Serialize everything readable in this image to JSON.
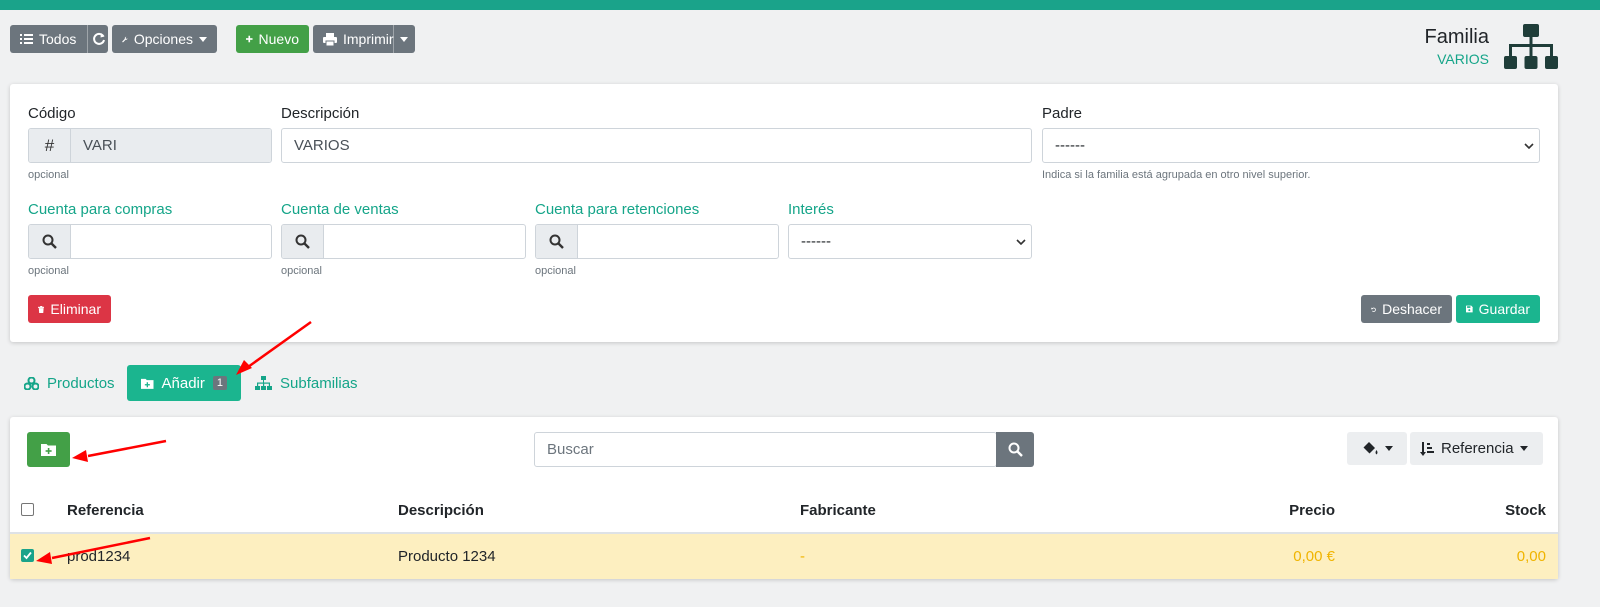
{
  "toolbar": {
    "todos_label": "Todos",
    "opciones_label": "Opciones",
    "nuevo_label": "Nuevo",
    "imprimir_label": "Imprimir"
  },
  "header": {
    "title": "Familia",
    "subtitle": "VARIOS",
    "icon": "sitemap-icon"
  },
  "form": {
    "codigo": {
      "label": "Código",
      "value": "VARI",
      "help": "opcional",
      "icon": "hash-icon"
    },
    "descripcion": {
      "label": "Descripción",
      "value": "VARIOS"
    },
    "padre": {
      "label": "Padre",
      "value": "------",
      "help": "Indica si la familia está agrupada en otro nivel superior."
    },
    "cuenta_compras": {
      "label": "Cuenta para compras",
      "value": "",
      "help": "opcional"
    },
    "cuenta_ventas": {
      "label": "Cuenta de ventas",
      "value": "",
      "help": "opcional"
    },
    "cuenta_retenciones": {
      "label": "Cuenta para retenciones",
      "value": "",
      "help": "opcional"
    },
    "interes": {
      "label": "Interés",
      "value": "------"
    },
    "eliminar_label": "Eliminar",
    "deshacer_label": "Deshacer",
    "guardar_label": "Guardar"
  },
  "tabs": [
    {
      "label": "Productos",
      "icon": "cubes-icon"
    },
    {
      "label": "Añadir",
      "badge": "1",
      "icon": "folder-plus-icon"
    },
    {
      "label": "Subfamilias",
      "icon": "sitemap-icon"
    }
  ],
  "list": {
    "search_placeholder": "Buscar",
    "sort_label": "Referencia",
    "columns": [
      "Referencia",
      "Descripción",
      "Fabricante",
      "Precio",
      "Stock"
    ],
    "rows": [
      {
        "referencia": "prod1234",
        "descripcion": "Producto 1234",
        "fabricante": "-",
        "precio": "0,00 €",
        "stock": "0,00",
        "checked": true
      }
    ]
  },
  "colors": {
    "accent": "#1aa38a",
    "green": "#43a047",
    "red": "#dc3545",
    "gray": "#6c757d",
    "row_highlight": "#fdefc0",
    "arrow": "#ff0000"
  }
}
